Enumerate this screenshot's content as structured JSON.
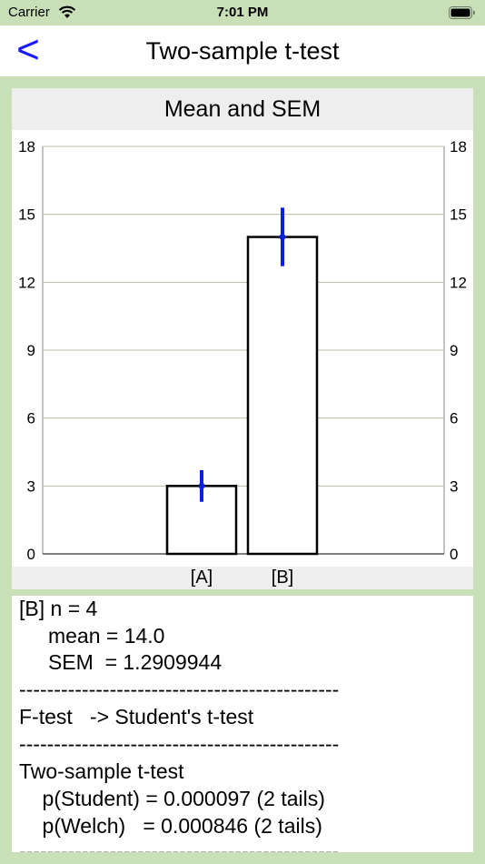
{
  "status_bar": {
    "carrier": "Carrier",
    "time": "7:01 PM"
  },
  "nav": {
    "back_label": "<",
    "title": "Two-sample t-test"
  },
  "colors": {
    "background": "#c8dfb8",
    "accent": "#1a1aff",
    "error_bar": "#0b1fe0"
  },
  "chart_data": {
    "type": "bar",
    "title": "Mean and SEM",
    "categories": [
      "[A]",
      "[B]"
    ],
    "values": [
      3.0,
      14.0
    ],
    "errors": [
      0.7,
      1.2909944
    ],
    "ylim": [
      0,
      18
    ],
    "yticks": [
      0,
      3,
      6,
      9,
      12,
      15,
      18
    ],
    "grid": true,
    "xlabel": "",
    "ylabel": ""
  },
  "results": [
    "[B] n = 4",
    "     mean = 14.0",
    "     SEM  = 1.2909944",
    "----------------------------------------------",
    "F-test   -> Student's t-test",
    "----------------------------------------------",
    "Two-sample t-test",
    "    p(Student) = 0.000097 (2 tails)",
    "    p(Welch)   = 0.000846 (2 tails)",
    "----------------------------------------------"
  ]
}
